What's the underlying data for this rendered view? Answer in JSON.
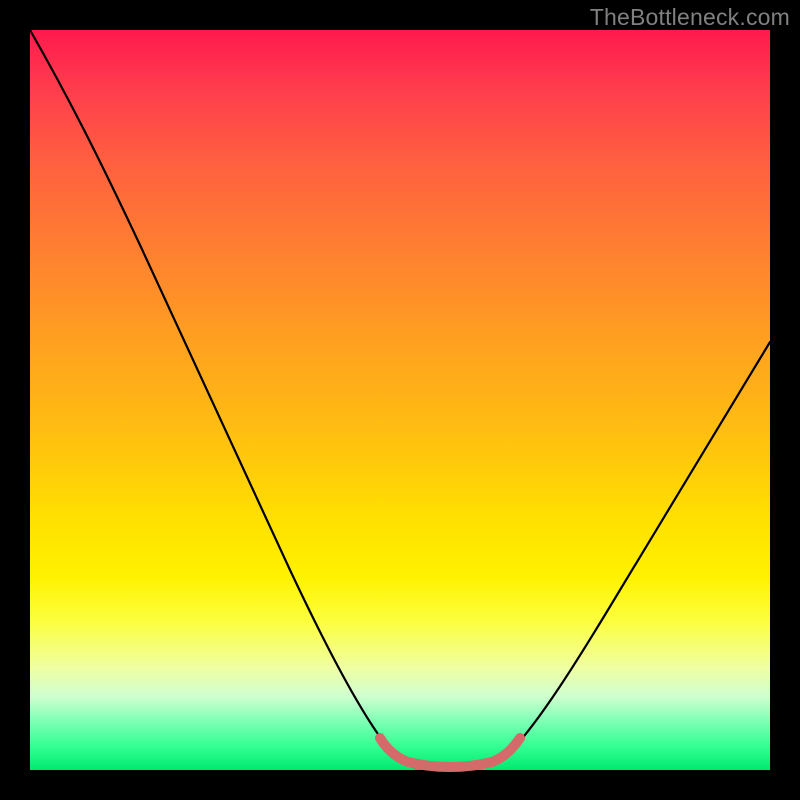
{
  "watermark": "TheBottleneck.com",
  "chart_data": {
    "type": "line",
    "title": "",
    "xlabel": "",
    "ylabel": "",
    "xlim": [
      0,
      100
    ],
    "ylim": [
      0,
      100
    ],
    "series": [
      {
        "name": "bottleneck-curve",
        "x": [
          0,
          7,
          14,
          21,
          28,
          35,
          42,
          47,
          50,
          53,
          55,
          58,
          61,
          64,
          68,
          75,
          82,
          90,
          100
        ],
        "y": [
          100,
          90,
          79,
          67,
          55,
          42,
          28,
          15,
          6,
          1,
          0,
          0,
          1,
          4,
          10,
          22,
          34,
          47,
          63
        ]
      },
      {
        "name": "sweet-spot-band",
        "x": [
          48,
          51,
          55,
          59,
          63,
          66
        ],
        "y": [
          4.5,
          1.8,
          1.2,
          1.2,
          2.0,
          5.0
        ]
      }
    ],
    "colors": {
      "curve": "#000000",
      "band": "#d46a6a",
      "gradient_top": "#ff1a4d",
      "gradient_bottom": "#00e870"
    }
  }
}
